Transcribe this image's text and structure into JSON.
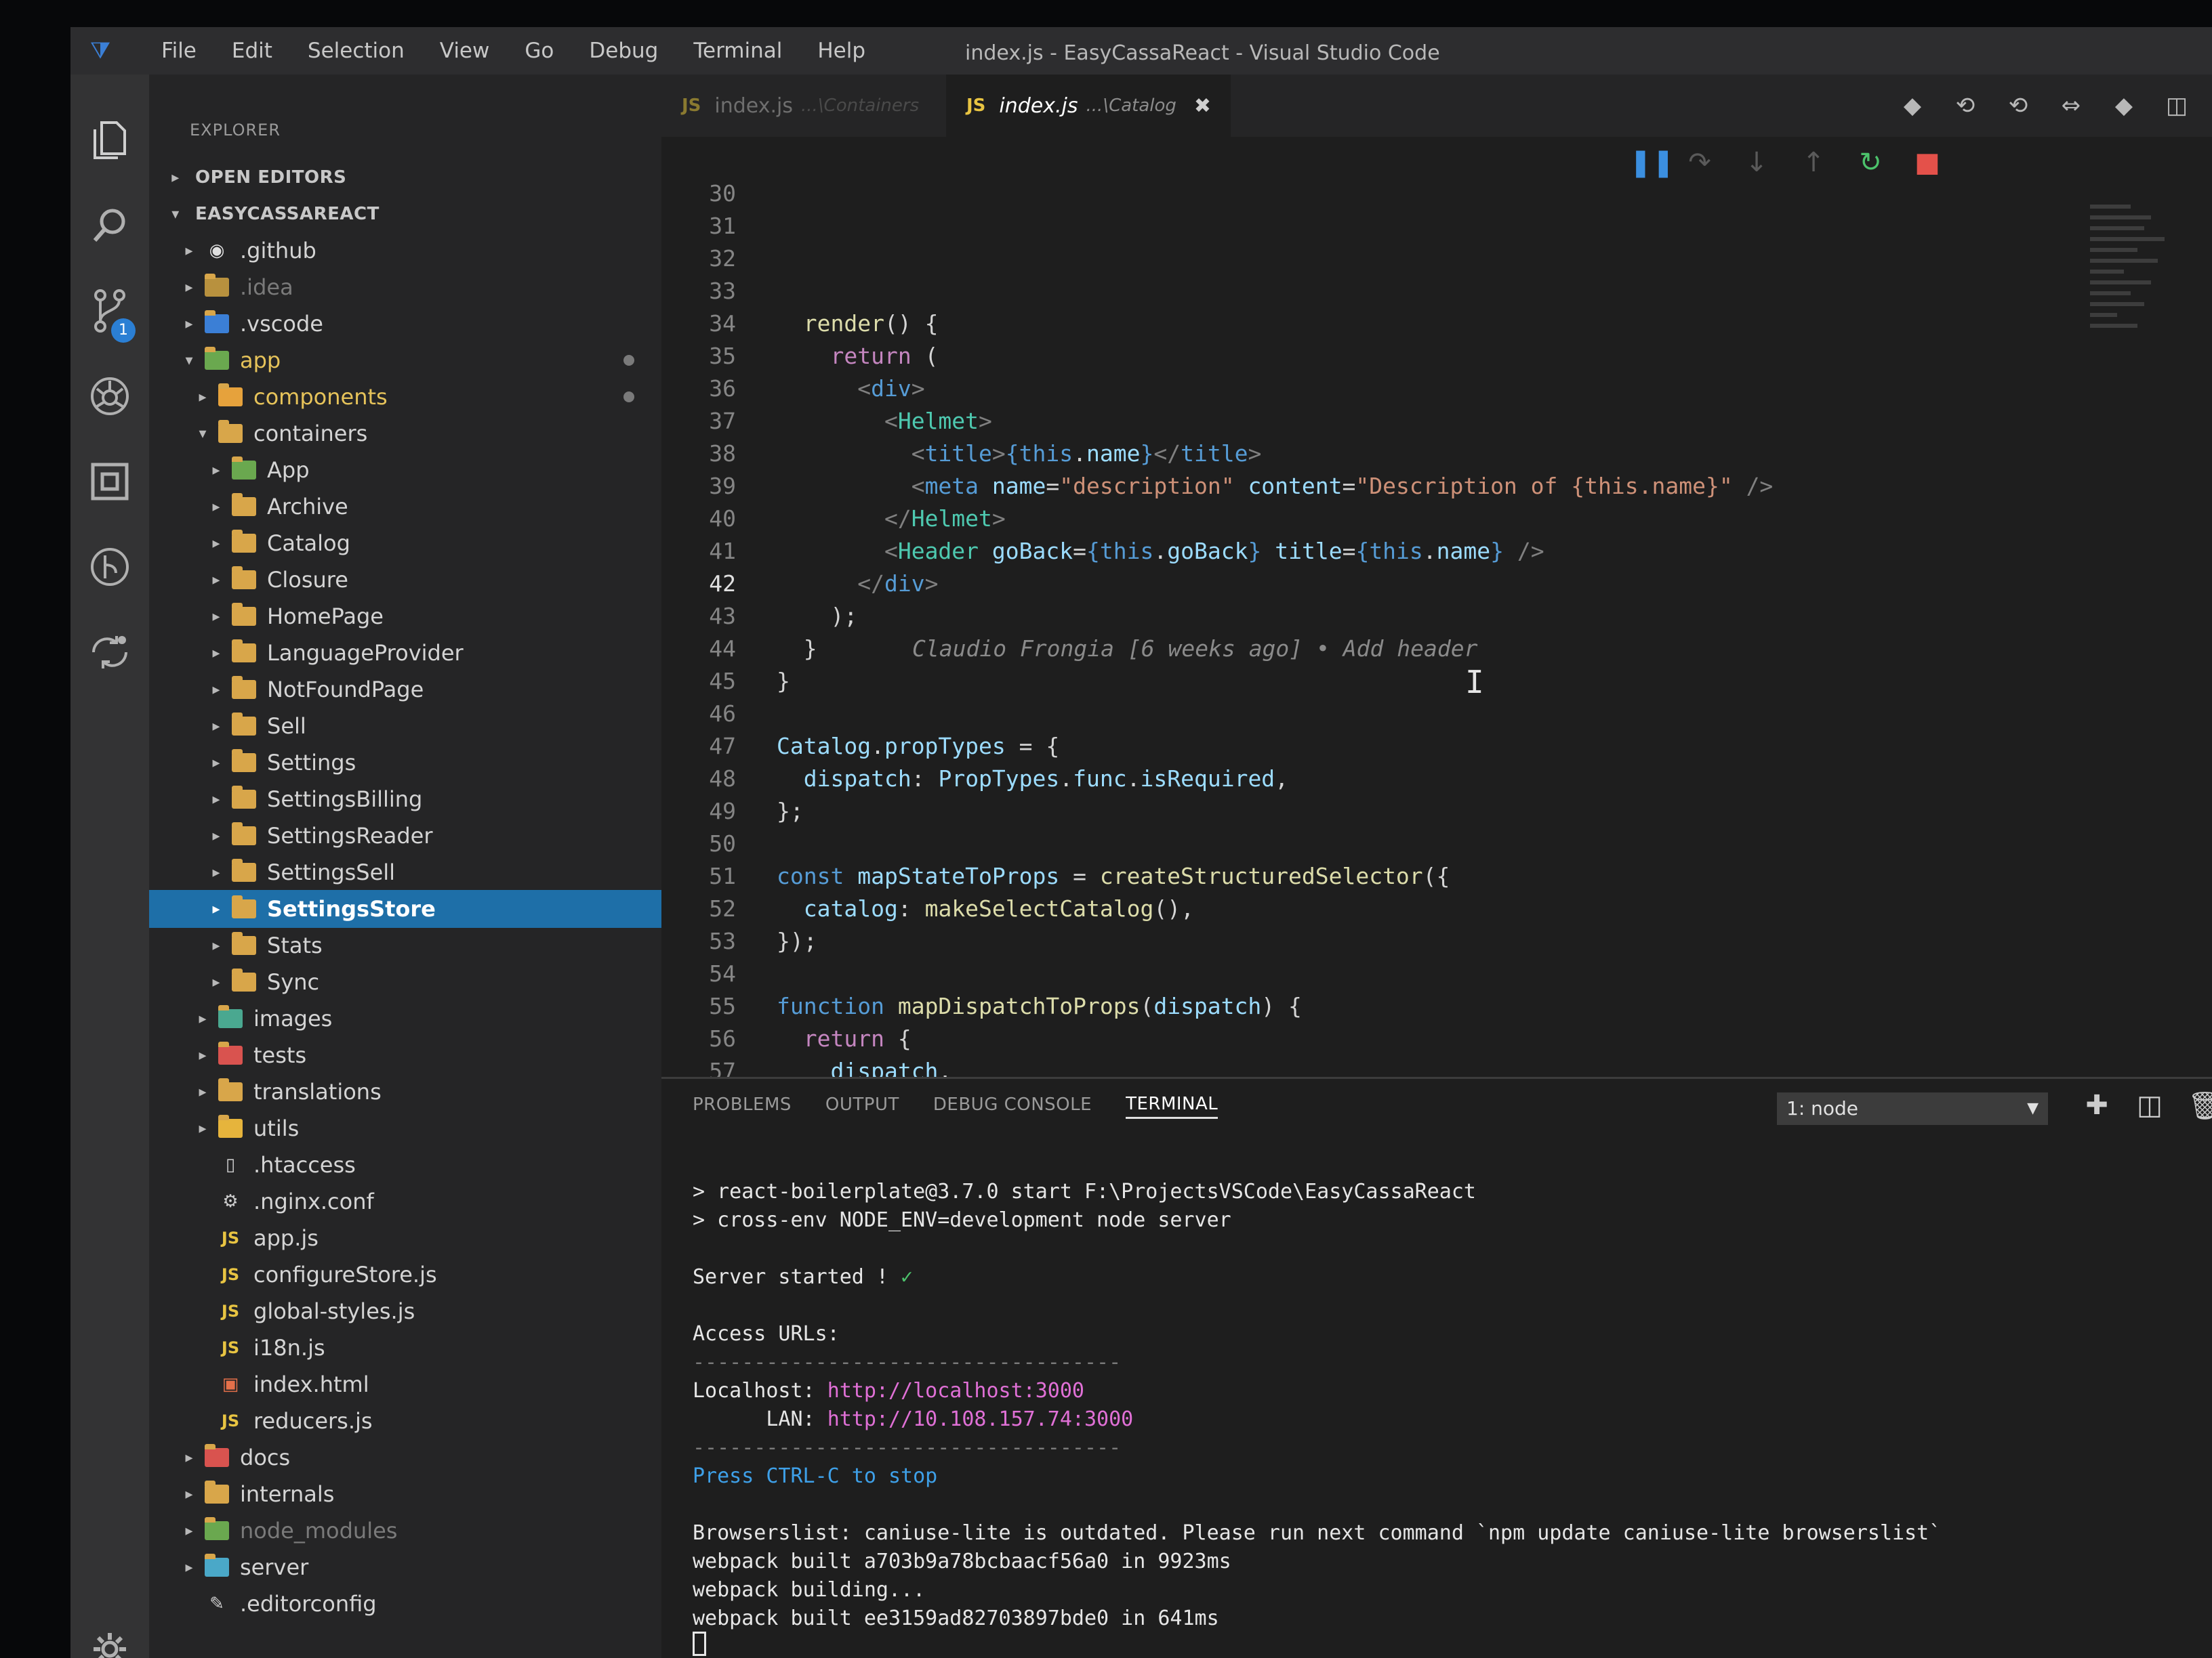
{
  "menu": [
    "File",
    "Edit",
    "Selection",
    "View",
    "Go",
    "Debug",
    "Terminal",
    "Help"
  ],
  "window_title": "index.js - EasyCassaReact - Visual Studio Code",
  "activity_badge": "1",
  "explorer": {
    "title": "EXPLORER",
    "open_editors": "OPEN EDITORS",
    "project": "EASYCASSAREACT",
    "items": {
      "github": ".github",
      "idea": ".idea",
      "vscode": ".vscode",
      "app": "app",
      "components": "components",
      "containers": "containers",
      "c_app": "App",
      "archive": "Archive",
      "catalog": "Catalog",
      "closure": "Closure",
      "homepage": "HomePage",
      "languageprovider": "LanguageProvider",
      "notfoundpage": "NotFoundPage",
      "sell": "Sell",
      "settings": "Settings",
      "settingsbilling": "SettingsBilling",
      "settingsreader": "SettingsReader",
      "settingssell": "SettingsSell",
      "settingsstore": "SettingsStore",
      "stats": "Stats",
      "sync": "Sync",
      "images": "images",
      "tests": "tests",
      "translations": "translations",
      "utils": "utils",
      "htaccess": ".htaccess",
      "nginx": ".nginx.conf",
      "appjs": "app.js",
      "configurestore": "configureStore.js",
      "globalstyles": "global-styles.js",
      "i18n": "i18n.js",
      "indexhtml": "index.html",
      "reducers": "reducers.js",
      "docs": "docs",
      "internals": "internals",
      "node_modules": "node_modules",
      "server": "server",
      "editorconfig": ".editorconfig"
    }
  },
  "tabs": {
    "js_badge": "JS",
    "tab1_name": "index.js",
    "tab1_path": "...\\Containers",
    "tab2_name": "index.js",
    "tab2_path": "...\\Catalog",
    "close": "✖"
  },
  "editor": {
    "ln": [
      "30",
      "31",
      "32",
      "33",
      "34",
      "35",
      "36",
      "37",
      "38",
      "39",
      "40",
      "41",
      "42",
      "43",
      "44",
      "45",
      "46",
      "47",
      "48",
      "49",
      "50",
      "51",
      "52",
      "53",
      "54",
      "55",
      "56",
      "57"
    ],
    "current_line": "42",
    "blame": "Claudio Frongia [6 weeks ago] • Add header"
  },
  "panel": {
    "tabs": [
      "PROBLEMS",
      "OUTPUT",
      "DEBUG CONSOLE",
      "TERMINAL"
    ],
    "terminal_select": "1: node",
    "lines": {
      "l1": "> react-boilerplate@3.7.0 start F:\\ProjectsVSCode\\EasyCassaReact",
      "l2": "> cross-env NODE_ENV=development node server",
      "l3": "Server started ! ",
      "l3_check": "✓",
      "l4": "Access URLs:",
      "sep": "-----------------------------------",
      "local_label": "Localhost: ",
      "local_url": "http://localhost:3000",
      "lan_label": "      LAN: ",
      "lan_url": "http://10.108.157.74:3000",
      "stop": "Press CTRL-C to stop",
      "bl": "Browserslist: caniuse-lite is outdated. Please run next command `npm update caniuse-lite browserslist`",
      "wp1": "webpack built a703b9a78bcbaacf56a0 in 9923ms",
      "wp2": "webpack building...",
      "wp3": "webpack built ee3159ad82703897bde0 in 641ms"
    }
  },
  "colors": {
    "selected_row": "#1e6fa8",
    "accent": "#2b7fd4",
    "folder": "#d8a64a"
  }
}
